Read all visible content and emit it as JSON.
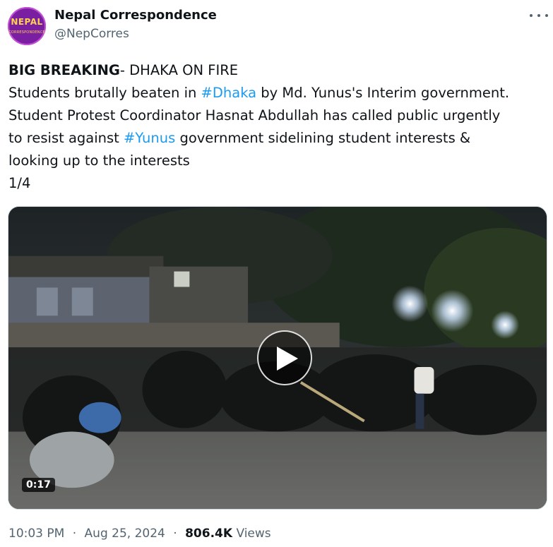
{
  "author": {
    "display_name": "Nepal Correspondence",
    "handle": "@NepCorres",
    "avatar_text_top": "NEPAL",
    "avatar_text_bottom": "CORRESPONDENCE",
    "more_icon": "more-horizontal-icon"
  },
  "tweet": {
    "line1_bold": "BIG BREAKING",
    "line1_rest": "- DHAKA ON FIRE",
    "line2_a": "Students brutally beaten in ",
    "hashtag1": "#Dhaka",
    "line2_b": " by Md. Yunus's Interim government.",
    "line3": "Student Protest Coordinator Hasnat Abdullah has called public urgently",
    "line4_a": "to resist against ",
    "hashtag2": "#Yunus",
    "line4_b": " government sidelining student interests &",
    "line5": "looking up to the interests",
    "line6": "1/4"
  },
  "media": {
    "duration": "0:17",
    "play_icon": "play-icon"
  },
  "meta": {
    "time": "10:03 PM",
    "date": "Aug 25, 2024",
    "views_count": "806.4K",
    "views_label": "Views",
    "separator": "·"
  },
  "colors": {
    "link": "#1d9bf0",
    "text": "#0f1419",
    "muted": "#536471",
    "avatar_bg": "#7a1fa2",
    "avatar_text": "#ffd34d"
  }
}
